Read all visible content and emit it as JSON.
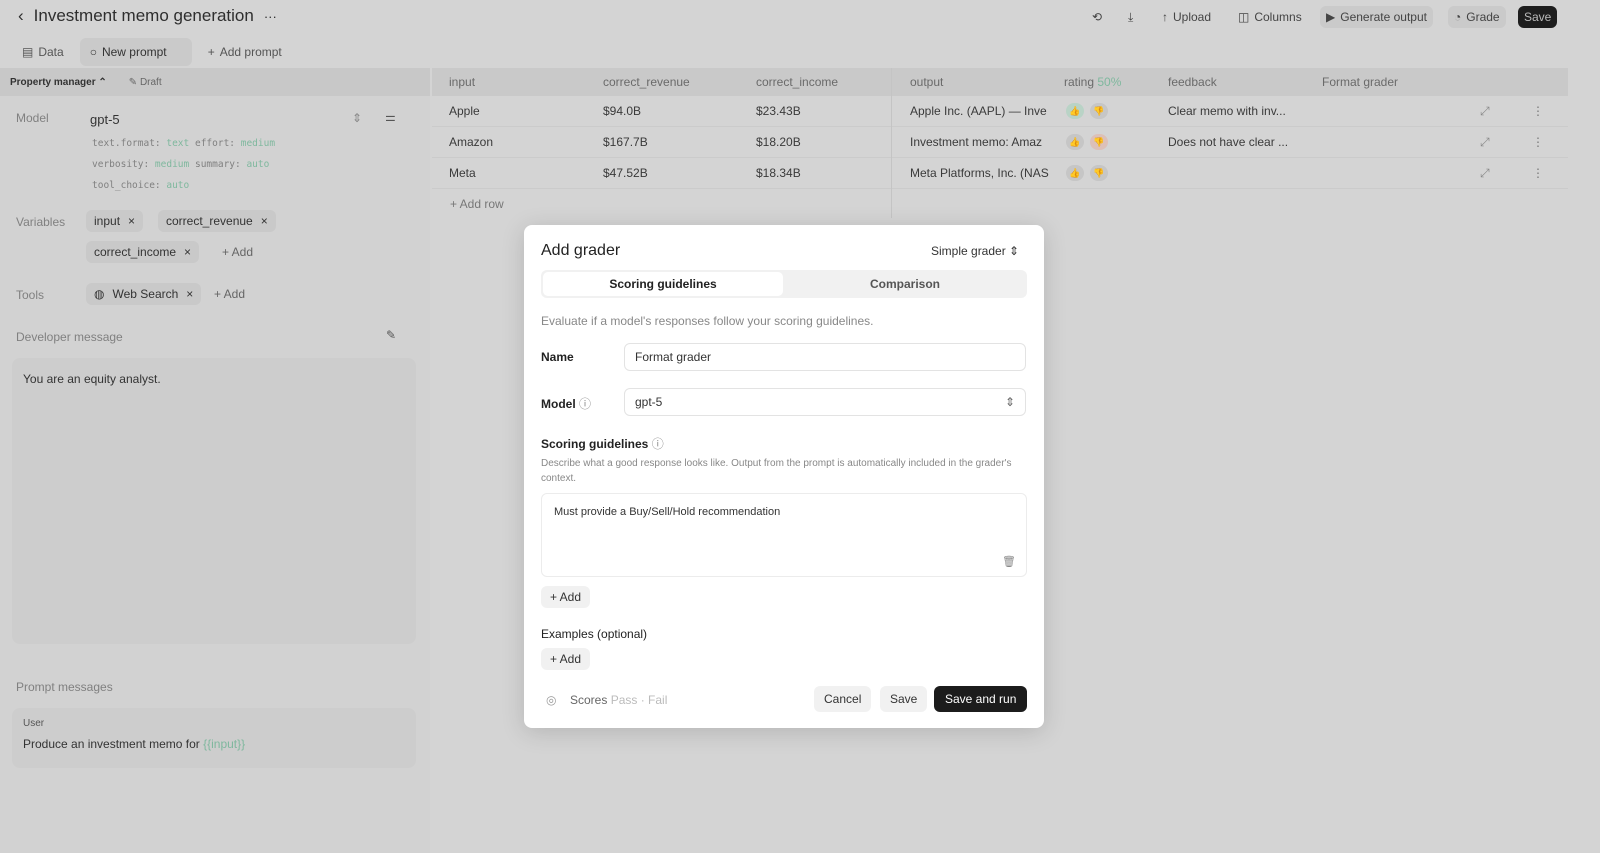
{
  "header": {
    "title": "Investment memo generation",
    "more": "···",
    "actions": [
      "Upload",
      "Columns",
      "Generate output",
      "Grade",
      "Save"
    ]
  },
  "tabs": [
    "Data",
    "New prompt",
    "Add prompt"
  ],
  "left": {
    "prompt_name": "Property manager",
    "draft": "Draft",
    "model_label": "Model",
    "model": "gpt-5",
    "params": [
      [
        "text.format: ",
        "text",
        " effort: ",
        "medium"
      ],
      [
        "verbosity: ",
        "medium",
        " summary: ",
        "auto"
      ],
      [
        "tool_choice: ",
        "auto",
        "",
        ""
      ]
    ],
    "variables_label": "Variables",
    "variables": [
      "input",
      "correct_revenue",
      "correct_income"
    ],
    "add": "+ Add",
    "tools_label": "Tools",
    "tools": [
      "Web Search"
    ],
    "dev_label": "Developer message",
    "dev_message": "You are an equity analyst.",
    "prompt_label": "Prompt messages",
    "role": "User",
    "user_msg": "Produce an investment memo for ",
    "user_var": "{{input}}"
  },
  "table": {
    "headers": [
      "input",
      "correct_revenue",
      "correct_income",
      "output",
      "rating",
      "feedback",
      "Format grader"
    ],
    "rating_pct": "50%",
    "rows": [
      [
        "Apple",
        "$94.0B",
        "$23.43B",
        "Apple Inc. (AAPL) — Inve",
        "Clear memo with inv..."
      ],
      [
        "Amazon",
        "$167.7B",
        "$18.20B",
        "Investment memo: Amaz",
        "Does not have clear ..."
      ],
      [
        "Meta",
        "$47.52B",
        "$18.34B",
        "Meta Platforms, Inc. (NAS",
        ""
      ]
    ],
    "add_row": "+ Add row"
  },
  "modal": {
    "title": "Add grader",
    "type": "Simple grader",
    "tabs": [
      "Scoring guidelines",
      "Comparison"
    ],
    "desc": "Evaluate if a model's responses follow your scoring guidelines.",
    "name_label": "Name",
    "name_value": "Format grader",
    "model_label": "Model",
    "model_value": "gpt-5",
    "sg_label": "Scoring guidelines",
    "sg_help": "Describe what a good response looks like. Output from the prompt is automatically included in the grader's context.",
    "guideline": "Must provide a Buy/Sell/Hold recommendation",
    "add": "+ Add",
    "examples_label": "Examples (optional)",
    "scores_label": "Scores",
    "scores_value": "Pass · Fail",
    "cancel": "Cancel",
    "save": "Save",
    "save_run": "Save and run"
  }
}
